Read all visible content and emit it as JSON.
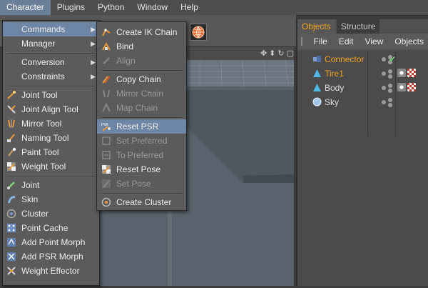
{
  "menubar": {
    "items": [
      "Character",
      "Plugins",
      "Python",
      "Window",
      "Help"
    ]
  },
  "character_menu": {
    "items": [
      {
        "label": "Commands",
        "submenu": true
      },
      {
        "label": "Manager",
        "submenu": true
      },
      {
        "label": "Conversion",
        "submenu": true
      },
      {
        "label": "Constraints",
        "submenu": true
      },
      {
        "label": "Joint Tool"
      },
      {
        "label": "Joint Align Tool"
      },
      {
        "label": "Mirror Tool"
      },
      {
        "label": "Naming Tool"
      },
      {
        "label": "Paint Tool"
      },
      {
        "label": "Weight Tool"
      },
      {
        "label": "Joint"
      },
      {
        "label": "Skin"
      },
      {
        "label": "Cluster"
      },
      {
        "label": "Point Cache"
      },
      {
        "label": "Add Point Morph"
      },
      {
        "label": "Add PSR Morph"
      },
      {
        "label": "Weight Effector"
      }
    ]
  },
  "commands_menu": {
    "items": [
      {
        "label": "Create IK Chain",
        "enabled": true
      },
      {
        "label": "Bind",
        "enabled": true
      },
      {
        "label": "Align",
        "enabled": false
      },
      {
        "label": "Copy Chain",
        "enabled": true
      },
      {
        "label": "Mirror Chain",
        "enabled": false
      },
      {
        "label": "Map Chain",
        "enabled": false
      },
      {
        "label": "Reset PSR",
        "enabled": true,
        "highlighted": true
      },
      {
        "label": "Set Preferred",
        "enabled": false
      },
      {
        "label": "To Preferred",
        "enabled": false
      },
      {
        "label": "Reset Pose",
        "enabled": true
      },
      {
        "label": "Set Pose",
        "enabled": false
      },
      {
        "label": "Create Cluster",
        "enabled": true
      }
    ]
  },
  "object_manager": {
    "tabs": [
      "Objects",
      "Structure"
    ],
    "menu": [
      "File",
      "Edit",
      "View",
      "Objects"
    ],
    "objects": [
      {
        "name": "Connector",
        "selected": true
      },
      {
        "name": "Tire1",
        "selected": true
      },
      {
        "name": "Body",
        "selected": false
      },
      {
        "name": "Sky",
        "selected": false
      }
    ]
  },
  "colors": {
    "accent_orange": "#f0a31e",
    "highlight_blue": "#6e86a6",
    "menu_bg": "#5b5b5b",
    "viewport_bg": "#59636d"
  }
}
